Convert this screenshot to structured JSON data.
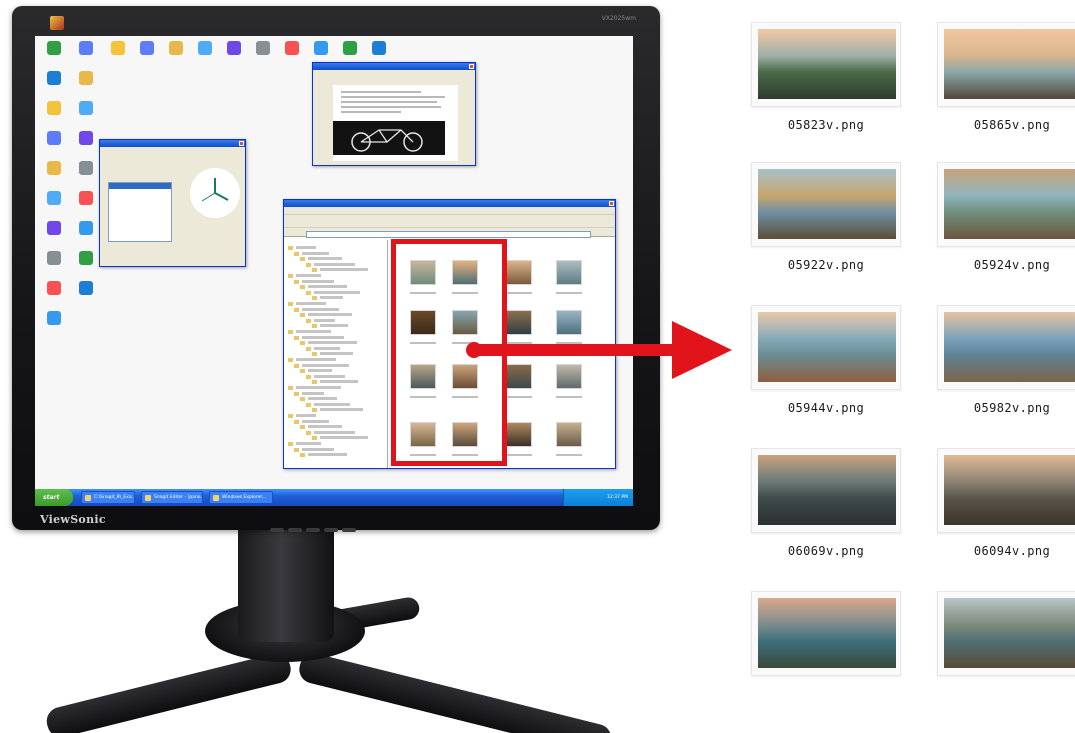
{
  "monitor": {
    "brand": "ViewSonic",
    "model_label": "VX2025wm"
  },
  "taskbar": {
    "start_label": "start",
    "items": [
      "C:\\Snagit_8\\_Exa...",
      "Snagit Editor - [pano...",
      "Windows Explorer..."
    ],
    "clock": "12:37 PM"
  },
  "thumbnails": [
    {
      "filename": "05823v.png",
      "palette": [
        "#f3c9a4",
        "#9fb0a8",
        "#4a6a46",
        "#2e3b30"
      ]
    },
    {
      "filename": "05865v.png",
      "palette": [
        "#f1c6a0",
        "#d9b68e",
        "#8aa7a8",
        "#51473a"
      ]
    },
    {
      "filename": "05922v.png",
      "palette": [
        "#a6c0c8",
        "#c7a66d",
        "#6f8fa2",
        "#5c4e38"
      ]
    },
    {
      "filename": "05924v.png",
      "palette": [
        "#c9a27a",
        "#8fb5bd",
        "#6f8e7a",
        "#6b5540"
      ]
    },
    {
      "filename": "05944v.png",
      "palette": [
        "#e9c9aa",
        "#86aab9",
        "#6b8b92",
        "#8f5e3e"
      ]
    },
    {
      "filename": "05982v.png",
      "palette": [
        "#e7c3a2",
        "#7aa3bd",
        "#5f8194",
        "#7c6548"
      ]
    },
    {
      "filename": "06069v.png",
      "palette": [
        "#c9a27e",
        "#6a7b78",
        "#3f4a4a",
        "#2b3030"
      ]
    },
    {
      "filename": "06094v.png",
      "palette": [
        "#e0b896",
        "#8d8474",
        "#5a5449",
        "#3a342c"
      ]
    },
    {
      "filename": "",
      "palette": [
        "#d9a98c",
        "#7c8c8d",
        "#3d6f7b",
        "#3a4a3a"
      ]
    },
    {
      "filename": "",
      "palette": [
        "#b8c6c8",
        "#7e8a7c",
        "#4f6f74",
        "#5a4a36"
      ]
    }
  ],
  "colors": {
    "highlight": "#e2141b",
    "xp_blue": "#0a4ecf",
    "xp_green": "#3a9a2a"
  },
  "icons": {
    "arrow": "right-arrow-icon"
  }
}
